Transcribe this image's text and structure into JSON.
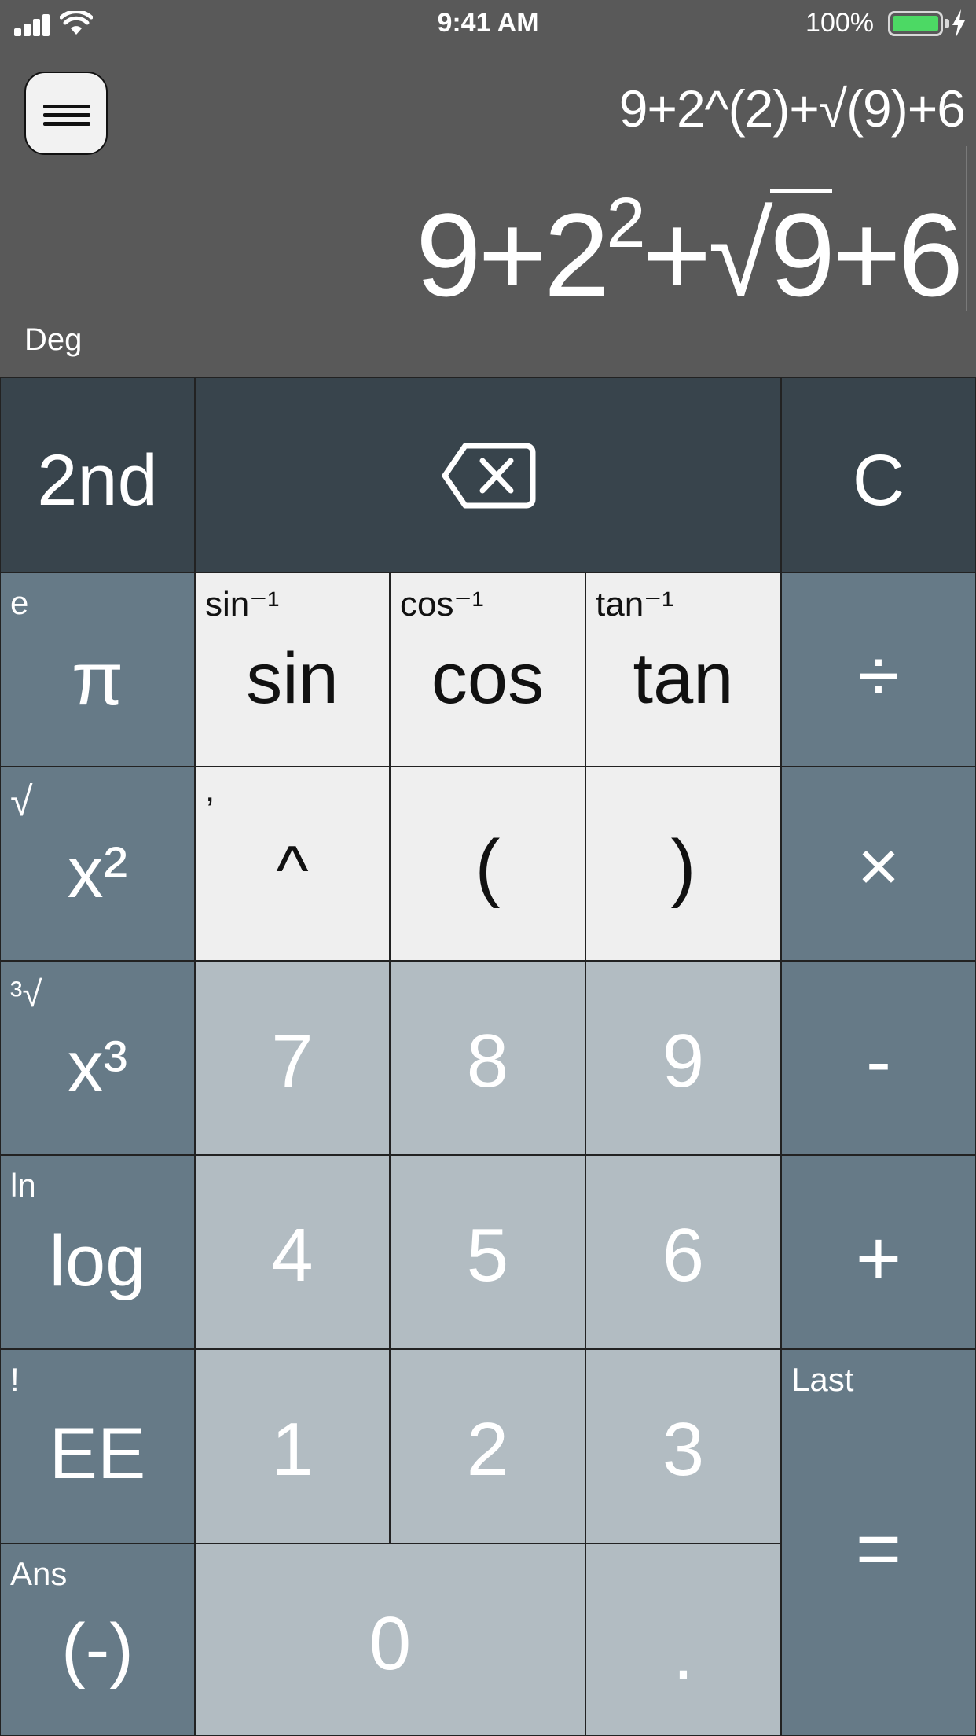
{
  "status_bar": {
    "time": "9:41 AM",
    "battery_percent": "100%",
    "battery_level": 1.0,
    "battery_color": "#4cd964",
    "icons": [
      "signal-icon",
      "wifi-icon",
      "battery-icon",
      "charging-bolt-icon"
    ]
  },
  "display": {
    "menu_icon": "hamburger-menu-icon",
    "input_before": "9+2^(2)+",
    "input_radical": "√",
    "input_after": "(9)+6",
    "result": {
      "part1": "9+2",
      "exponent": "2",
      "part2": "+",
      "radical": "√",
      "radicand": "9",
      "part3": "+6"
    },
    "mode": "Deg"
  },
  "keys": {
    "second": "2nd",
    "backspace_icon": "backspace-icon",
    "clear": "C",
    "pi": {
      "main": "π",
      "alt": "e"
    },
    "sin": {
      "main": "sin",
      "alt": "sin⁻¹"
    },
    "cos": {
      "main": "cos",
      "alt": "cos⁻¹"
    },
    "tan": {
      "main": "tan",
      "alt": "tan⁻¹"
    },
    "divide": "÷",
    "square": {
      "main": "x²",
      "alt": "√"
    },
    "power": {
      "main": "^",
      "alt": ","
    },
    "open_paren": "(",
    "close_paren": ")",
    "multiply": "×",
    "cube": {
      "main": "x³",
      "alt": "³√"
    },
    "seven": "7",
    "eight": "8",
    "nine": "9",
    "minus": "-",
    "log": {
      "main": "log",
      "alt": "ln"
    },
    "four": "4",
    "five": "5",
    "six": "6",
    "plus": "+",
    "ee": {
      "main": "EE",
      "alt": "!"
    },
    "one": "1",
    "two": "2",
    "three": "3",
    "equals": {
      "main": "=",
      "alt": "Last"
    },
    "negate": {
      "main": "(-)",
      "alt": "Ans"
    },
    "zero": "0",
    "decimal": "."
  },
  "colors": {
    "display_bg": "#595959",
    "top_row_key": "#38444c",
    "function_key": "#667a87",
    "trig_key": "#efefef",
    "number_key": "#b2bcc2"
  }
}
